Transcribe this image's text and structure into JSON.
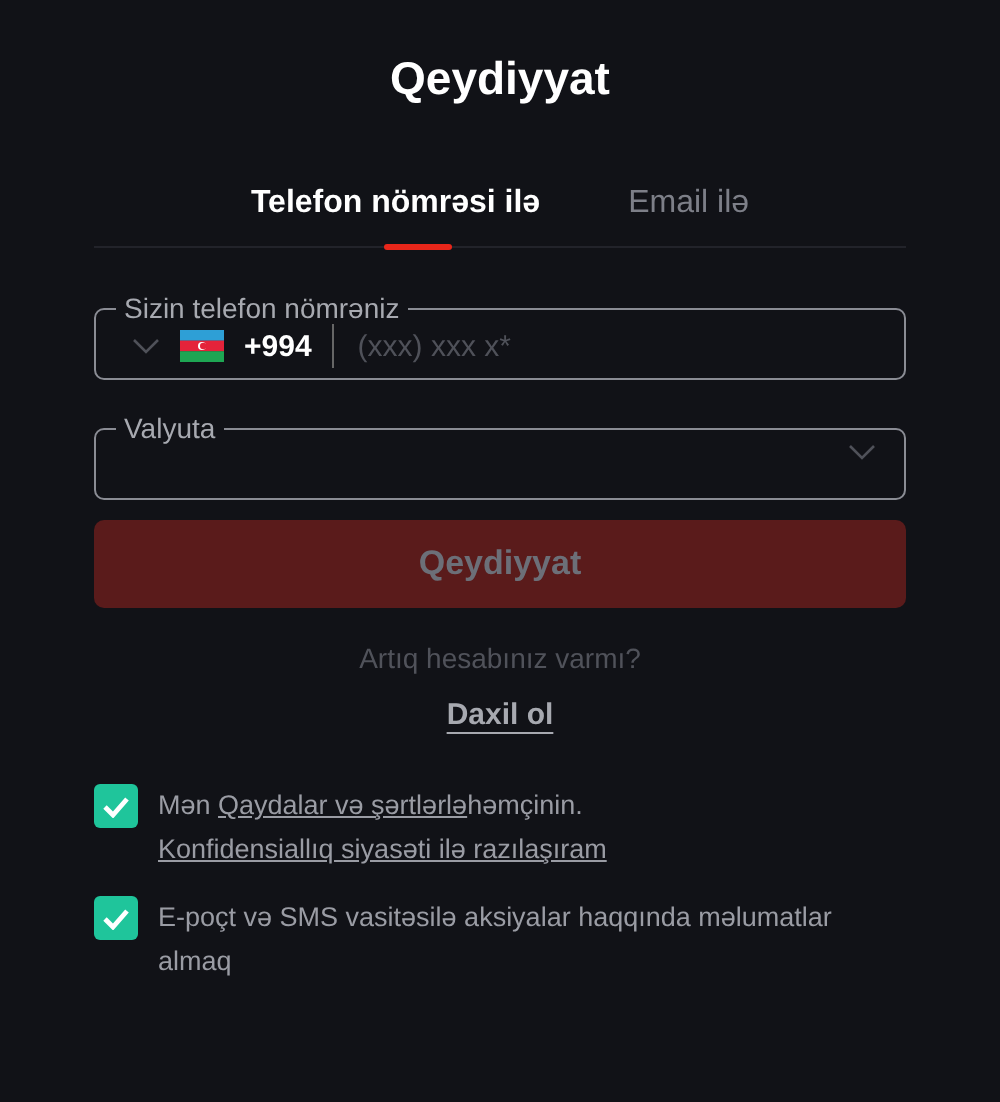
{
  "title": "Qeydiyyat",
  "tabs": [
    {
      "label": "Telefon nömrəsi ilə",
      "selected": true
    },
    {
      "label": "Email ilə",
      "selected": false
    }
  ],
  "phone_field": {
    "label": "Sizin telefon nömrəniz",
    "country_code": "+994",
    "placeholder": "(xxx) xxx x*"
  },
  "currency_field": {
    "label": "Valyuta"
  },
  "submit_button": {
    "label": "Qeydiyyat",
    "disabled": true
  },
  "login_prompt": "Artıq hesabınız varmı?",
  "login_link": "Daxil ol",
  "consents": [
    {
      "checked": true,
      "parts": [
        {
          "text": "Mən ",
          "link": false
        },
        {
          "text": "Qaydalar və şərtlərlə",
          "link": true
        },
        {
          "text": "həmçinin. ",
          "link": false
        },
        {
          "text": "Konfidensiallıq siyasəti ilə razılaşıram",
          "link": true
        }
      ]
    },
    {
      "checked": true,
      "parts": [
        {
          "text": "E-poçt və SMS vasitəsilə aksiyalar haqqında məlumatlar almaq",
          "link": false
        }
      ]
    }
  ]
}
